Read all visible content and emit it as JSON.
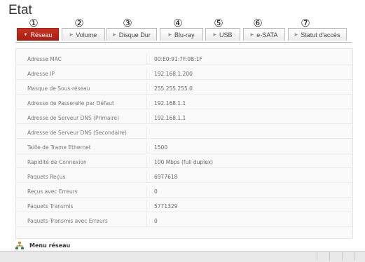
{
  "page": {
    "title": "Etat"
  },
  "callouts": [
    "①",
    "②",
    "③",
    "④",
    "⑤",
    "⑥",
    "⑦"
  ],
  "tabs": [
    {
      "label": "Réseau",
      "active": true
    },
    {
      "label": "Volume",
      "active": false
    },
    {
      "label": "Disque Dur",
      "active": false
    },
    {
      "label": "Blu-ray",
      "active": false
    },
    {
      "label": "USB",
      "active": false
    },
    {
      "label": "e-SATA",
      "active": false
    },
    {
      "label": "Statut d'accès",
      "active": false
    }
  ],
  "rows": [
    {
      "label": "Adresse MAC",
      "value": "00:E0:91:7F:0B:1F"
    },
    {
      "label": "Adresse IP",
      "value": "192.168.1.200"
    },
    {
      "label": "Masque de Sous-réseau",
      "value": "255.255.255.0"
    },
    {
      "label": "Adresse de Passerelle par Défaut",
      "value": "192.168.1.1"
    },
    {
      "label": "Adresse de Serveur DNS (Primaire)",
      "value": "192.168.1.1"
    },
    {
      "label": "Adresse de Serveur DNS (Secondaire)",
      "value": ""
    },
    {
      "label": "Taille de Trame Ethernet",
      "value": "1500"
    },
    {
      "label": "Rapidité de Connexion",
      "value": "100 Mbps (full duplex)"
    },
    {
      "label": "Paquets Reçus",
      "value": "6977618"
    },
    {
      "label": "Reçus avec Erreurs",
      "value": "0"
    },
    {
      "label": "Paquets Transmis",
      "value": "5771329"
    },
    {
      "label": "Paquets Transmis avec Erreurs",
      "value": "0"
    }
  ],
  "footer": {
    "menu_label": "Menu réseau",
    "icon": "network-icon"
  },
  "colors": {
    "active_tab": "#b8281a",
    "text": "#777777"
  }
}
